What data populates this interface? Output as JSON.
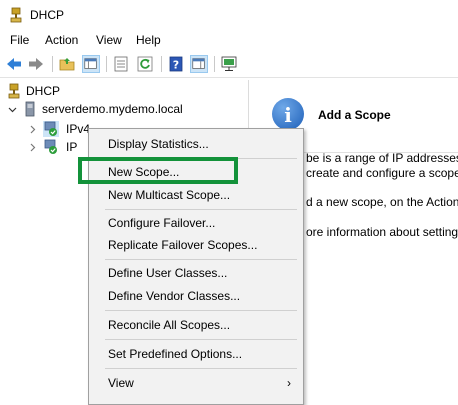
{
  "window": {
    "title": "DHCP"
  },
  "menu": [
    "File",
    "Action",
    "View",
    "Help"
  ],
  "toolbar": {
    "icons": [
      "back-icon",
      "forward-icon",
      "up-folder-icon",
      "console-tree-icon",
      "properties-icon",
      "refresh-icon",
      "help-icon",
      "action-pane-icon",
      "export-list-icon"
    ]
  },
  "tree": {
    "root": "DHCP",
    "server": "serverdemo.mydemo.local",
    "ipv4": "IPv4",
    "ipv6_partial": "IP"
  },
  "right_pane": {
    "title": "Add a Scope",
    "lines": [
      "be is a range of IP addresses as",
      "create and configure a scope I",
      "d a new scope, on the Action m",
      "ore information about setting"
    ]
  },
  "context_menu": {
    "items": [
      "Display Statistics...",
      "New Scope...",
      "New Multicast Scope...",
      "Configure Failover...",
      "Replicate Failover Scopes...",
      "Define User Classes...",
      "Define Vendor Classes...",
      "Reconcile All Scopes...",
      "Set Predefined Options...",
      "View"
    ],
    "submenu_arrow": "›"
  },
  "colors": {
    "highlight_box": "#13923a",
    "selected_node": "#cce4f7"
  }
}
